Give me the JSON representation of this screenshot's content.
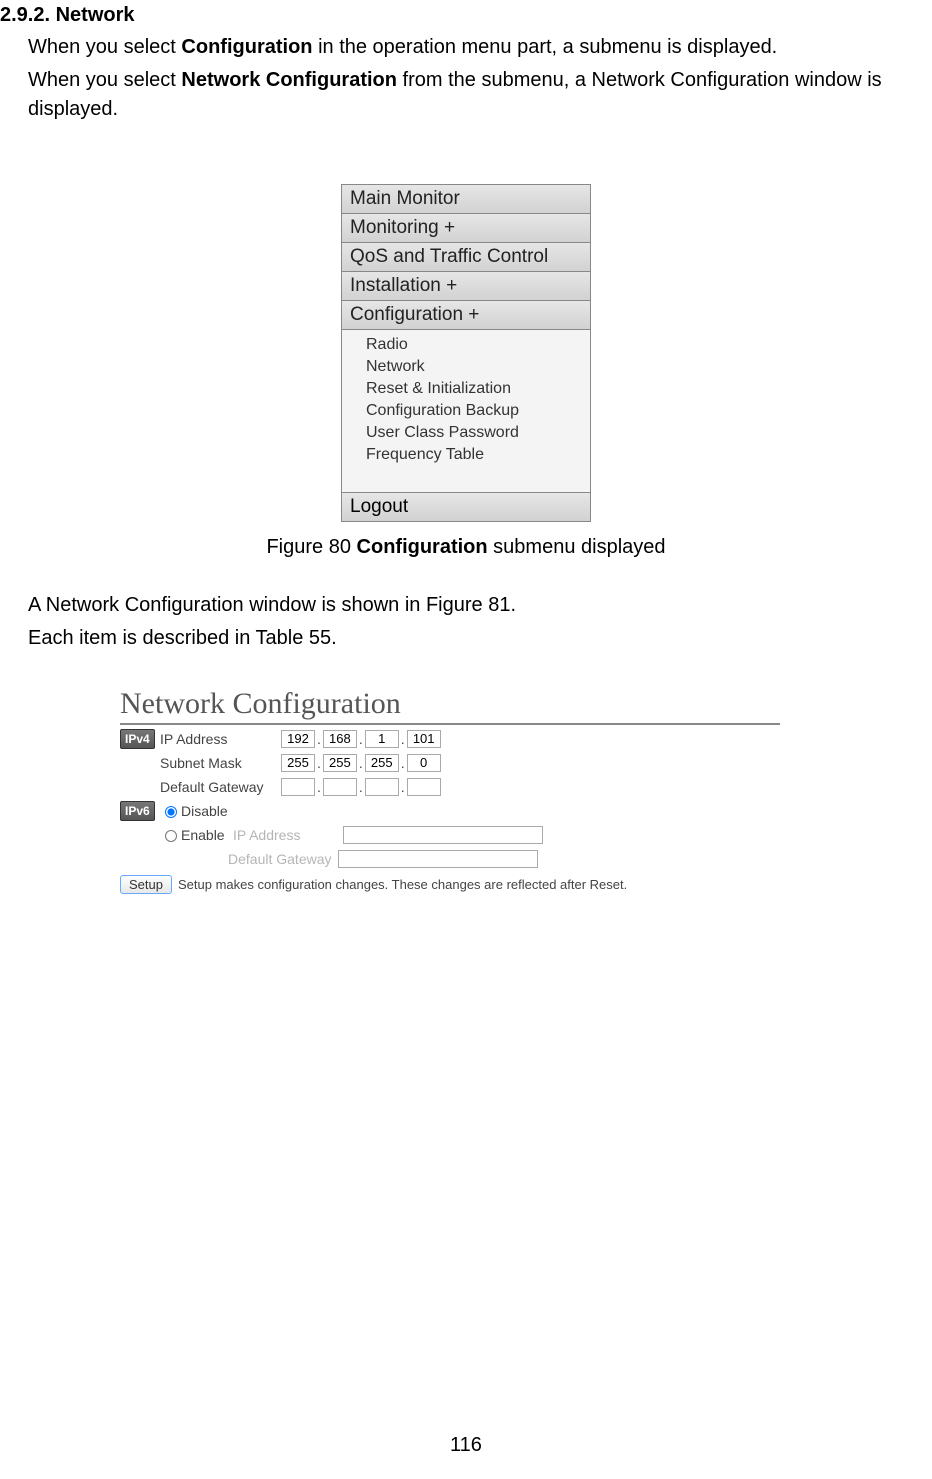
{
  "section_number": "2.9.2. Network",
  "intro": {
    "p1_pre": "When you select ",
    "p1_bold": "Configuration",
    "p1_post": " in the operation menu part, a submenu is displayed.",
    "p2_pre": "When you select ",
    "p2_bold": "Network Configuration",
    "p2_post": " from the submenu, a Network Configuration window is displayed."
  },
  "menu": {
    "items_top": [
      "Main Monitor",
      "Monitoring +",
      "QoS and Traffic Control",
      "Installation +",
      "Configuration +"
    ],
    "subitems": [
      "Radio",
      "Network",
      "Reset & Initialization",
      "Configuration Backup",
      "User Class Password",
      "Frequency Table"
    ],
    "logout": "Logout"
  },
  "figure80_caption_pre": "Figure 80 ",
  "figure80_caption_bold": "Configuration",
  "figure80_caption_post": " submenu displayed",
  "mid": {
    "p1": "A Network Configuration window is shown in Figure 81.",
    "p2": "Each item is described in Table 55."
  },
  "netconf": {
    "title": "Network Configuration",
    "ipv4_badge": "IPv4",
    "ipv6_badge": "IPv6",
    "labels": {
      "ip": "IP Address",
      "subnet": "Subnet Mask",
      "gateway": "Default Gateway",
      "disable": "Disable",
      "enable": "Enable",
      "ipv6_ip": "IP Address",
      "ipv6_gw": "Default Gateway"
    },
    "ip": [
      "192",
      "168",
      "1",
      "101"
    ],
    "subnet": [
      "255",
      "255",
      "255",
      "0"
    ],
    "gateway": [
      "",
      "",
      "",
      ""
    ],
    "setup_btn": "Setup",
    "setup_text": "Setup makes configuration changes. These changes are reflected after Reset."
  },
  "page_number": "116"
}
